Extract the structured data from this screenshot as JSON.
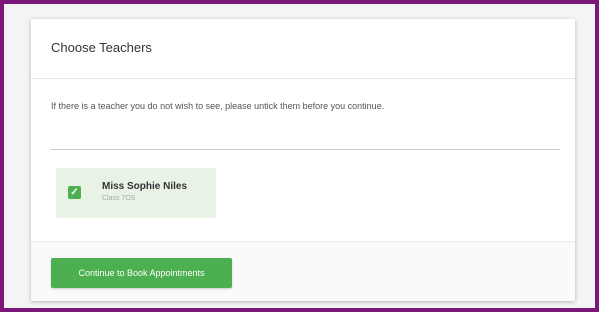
{
  "card": {
    "title": "Choose Teachers",
    "instruction": "If there is a teacher you do not wish to see, please untick them before you continue."
  },
  "teachers": [
    {
      "name": "Miss Sophie Niles",
      "subtitle": "Class 7OS",
      "checked": true,
      "check_glyph": "✓"
    }
  ],
  "footer": {
    "continue_label": "Continue to Book Appointments"
  },
  "colors": {
    "frame_border": "#7b177b",
    "accent_green": "#4caf50",
    "teacher_card_bg": "#e8f3e6"
  },
  "icons": {
    "checkbox": "checkbox-checked-icon"
  }
}
